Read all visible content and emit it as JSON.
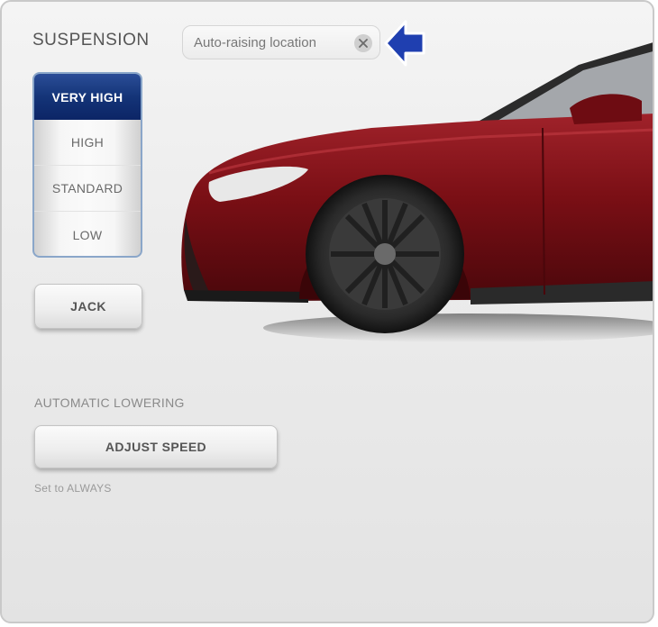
{
  "header": {
    "title": "SUSPENSION",
    "chip_text": "Auto-raising location",
    "close_icon": "close-icon",
    "arrow_icon": "left-arrow-icon"
  },
  "suspension": {
    "levels": [
      {
        "label": "VERY HIGH",
        "selected": true
      },
      {
        "label": "HIGH",
        "selected": false
      },
      {
        "label": "STANDARD",
        "selected": false
      },
      {
        "label": "LOW",
        "selected": false
      }
    ]
  },
  "jack": {
    "label": "JACK"
  },
  "automatic_lowering": {
    "section_label": "AUTOMATIC LOWERING",
    "button_label": "ADJUST SPEED",
    "status": "Set to ALWAYS"
  },
  "colors": {
    "accent_blue": "#143478",
    "arrow_blue": "#1f3fb0",
    "car_red": "#7a0f15",
    "panel_bg": "#ececec"
  }
}
